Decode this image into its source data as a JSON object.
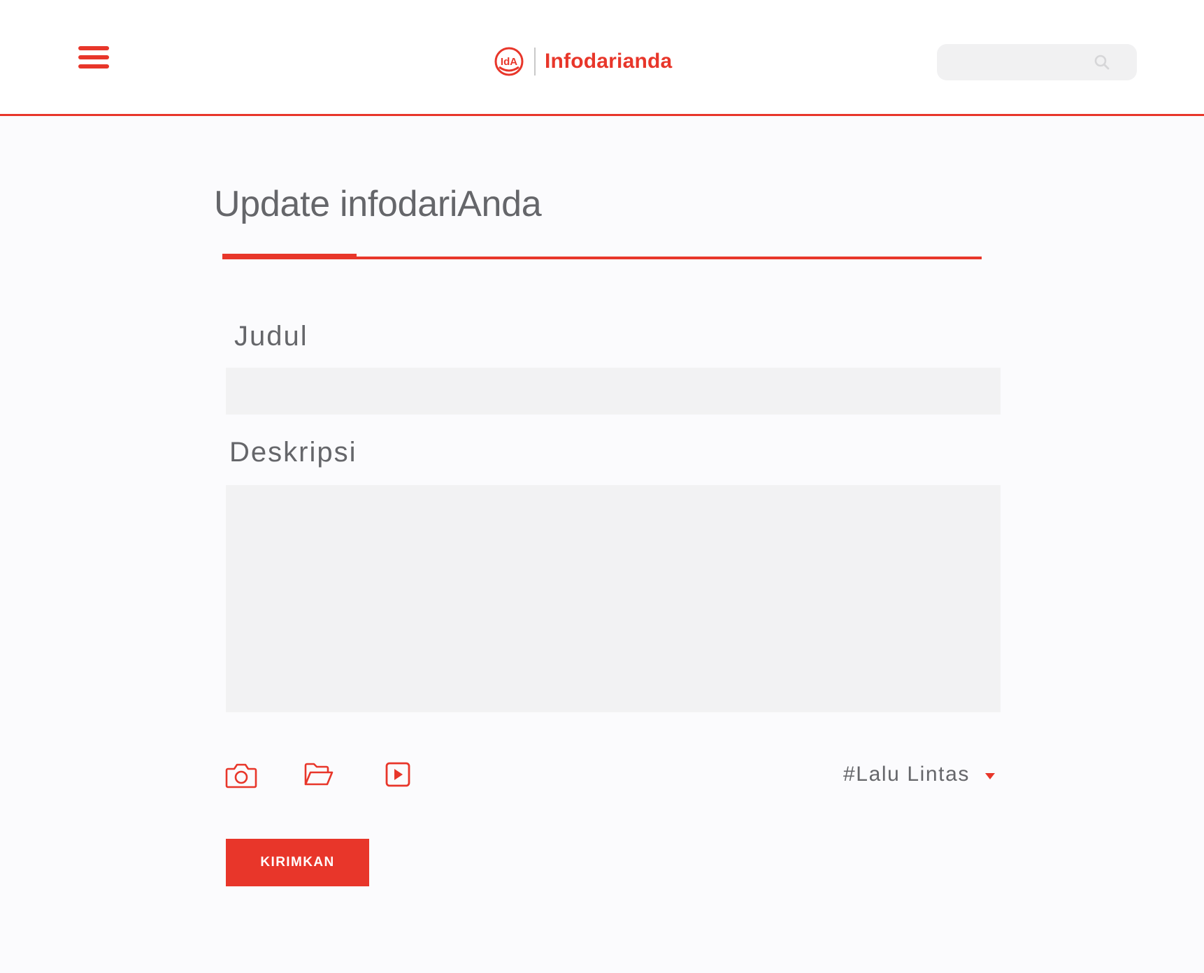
{
  "colors": {
    "brand": "#e8362a",
    "text": "#65666a",
    "field_bg": "#f2f2f3",
    "page_bg": "#fbfbfd"
  },
  "header": {
    "menu_icon": "hamburger-menu-icon",
    "logo_mark_text": "IdA",
    "brand_name": "Infodarianda",
    "search": {
      "placeholder": "",
      "icon": "search-icon"
    }
  },
  "form": {
    "page_title": "Update infodariAnda",
    "title_field": {
      "label": "Judul",
      "value": "",
      "placeholder": ""
    },
    "description_field": {
      "label": "Deskripsi",
      "value": "",
      "placeholder": ""
    },
    "attachments": [
      {
        "icon": "camera-icon"
      },
      {
        "icon": "folder-open-icon"
      },
      {
        "icon": "video-play-icon"
      }
    ],
    "category": {
      "selected": "#Lalu Lintas",
      "icon": "caret-down-icon"
    },
    "submit_label": "KIRIMKAN"
  }
}
